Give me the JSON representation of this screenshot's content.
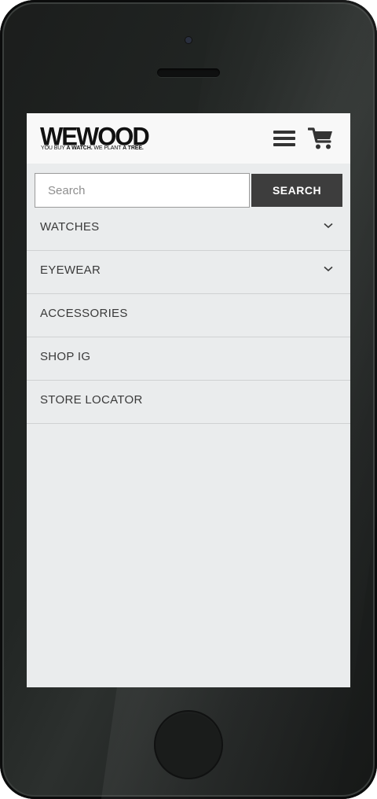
{
  "brand": {
    "name": "WEWOOD",
    "tagline_part1": "YOU BUY ",
    "tagline_part2": "A WATCH.",
    "tagline_part3": " WE PLANT ",
    "tagline_part4": "A TREE."
  },
  "header": {
    "menu_icon": "hamburger-menu-icon",
    "cart_icon": "shopping-cart-icon"
  },
  "search": {
    "placeholder": "Search",
    "value": "",
    "button_label": "SEARCH"
  },
  "nav": {
    "items": [
      {
        "label": "WATCHES",
        "has_submenu": true
      },
      {
        "label": "EYEWEAR",
        "has_submenu": true
      },
      {
        "label": "ACCESSORIES",
        "has_submenu": false
      },
      {
        "label": "SHOP IG",
        "has_submenu": false
      },
      {
        "label": "STORE LOCATOR",
        "has_submenu": false
      }
    ]
  },
  "colors": {
    "header_bg": "#f8f8f8",
    "menu_bg": "#eaeced",
    "button_bg": "#3d3d3d",
    "text": "#3a3a3a"
  }
}
